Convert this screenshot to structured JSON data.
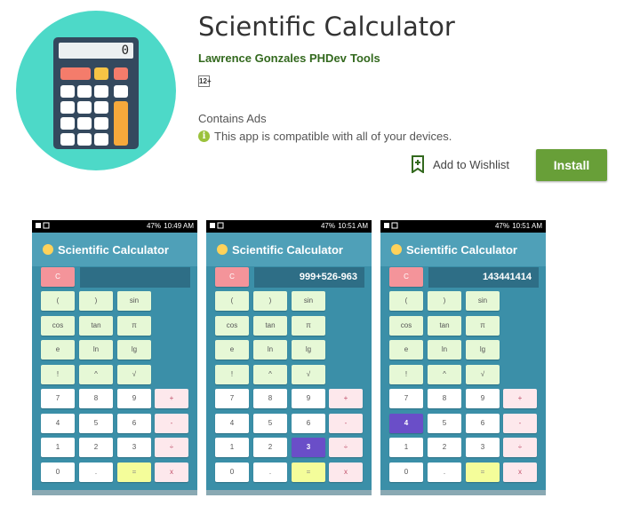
{
  "app": {
    "title": "Scientific Calculator",
    "developer": "Lawrence Gonzales PHDev",
    "category": "Tools",
    "content_rating": "12+",
    "contains_ads": "Contains Ads",
    "compatibility": "This app is compatible with all of your devices.",
    "wishlist_label": "Add to Wishlist",
    "install_label": "Install",
    "icon_display": "0"
  },
  "colors": {
    "install_green": "#689f38",
    "developer_green": "#33691e",
    "icon_teal": "#4dd9c8",
    "screenshot_bg": "#3b8fa8"
  },
  "screenshots": [
    {
      "time": "10:49 AM",
      "battery": "47%",
      "app_title": "Scientific Calculator",
      "display": "",
      "clear": "C",
      "keys": [
        "(",
        ")",
        "sin",
        "cos",
        "tan",
        "π",
        "e",
        "ln",
        "lg",
        "!",
        "^",
        "√",
        "7",
        "8",
        "9",
        "+",
        "4",
        "5",
        "6",
        "-",
        "1",
        "2",
        "3",
        "÷",
        "0",
        ".",
        "=",
        "x"
      ]
    },
    {
      "time": "10:51 AM",
      "battery": "47%",
      "app_title": "Scientific Calculator",
      "display": "999+526-963",
      "clear": "C",
      "keys": [
        "(",
        ")",
        "sin",
        "cos",
        "tan",
        "π",
        "e",
        "ln",
        "lg",
        "!",
        "^",
        "√",
        "7",
        "8",
        "9",
        "+",
        "4",
        "5",
        "6",
        "-",
        "1",
        "2",
        "3",
        "÷",
        "0",
        ".",
        "=",
        "x"
      ]
    },
    {
      "time": "10:51 AM",
      "battery": "47%",
      "app_title": "Scientific Calculator",
      "display": "143441414",
      "clear": "C",
      "keys": [
        "(",
        ")",
        "sin",
        "cos",
        "tan",
        "π",
        "e",
        "ln",
        "lg",
        "!",
        "^",
        "√",
        "7",
        "8",
        "9",
        "+",
        "4",
        "5",
        "6",
        "-",
        "1",
        "2",
        "3",
        "÷",
        "0",
        ".",
        "=",
        "x"
      ]
    }
  ]
}
